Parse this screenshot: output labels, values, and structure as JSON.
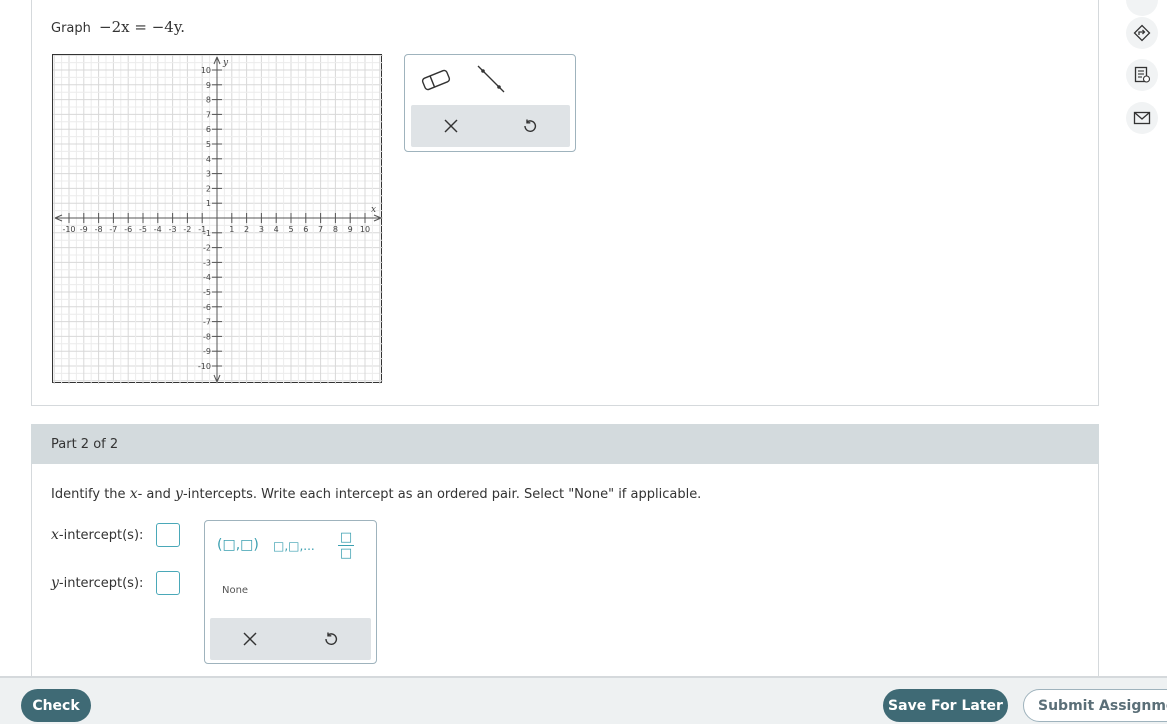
{
  "part1": {
    "prompt_label": "Graph",
    "equation": "−2x = −4y.",
    "graph": {
      "x_axis_label": "x",
      "y_axis_label": "y",
      "x_tick_labels": [
        "-10",
        "-9",
        "-8",
        "-7",
        "-6",
        "-5",
        "-4",
        "-3",
        "-2",
        "-1",
        "1",
        "2",
        "3",
        "4",
        "5",
        "6",
        "7",
        "8",
        "9",
        "10"
      ],
      "y_tick_labels": [
        "10",
        "9",
        "8",
        "7",
        "6",
        "5",
        "4",
        "3",
        "2",
        "1",
        "-1",
        "-2",
        "-3",
        "-4",
        "-5",
        "-6",
        "-7",
        "-8",
        "-9",
        "-10"
      ],
      "x_range": [
        -10,
        10
      ],
      "y_range": [
        -10,
        10
      ],
      "grid": true
    },
    "tools": {
      "eraser": "eraser-icon",
      "line": "line-tool-icon",
      "clear": "close-icon",
      "undo": "undo-icon"
    }
  },
  "part2": {
    "header": "Part 2 of 2",
    "instruction_pre": "Identify the ",
    "x_var": "x",
    "instruction_mid": "- and ",
    "y_var": "y",
    "instruction_post": "-intercepts. Write each intercept as an ordered pair. Select \"None\" if applicable.",
    "x_intercept_var": "x",
    "x_intercept_label": "-intercept(s):",
    "y_intercept_var": "y",
    "y_intercept_label": "-intercept(s):",
    "templates": {
      "ordered_pair": "(□,□)",
      "list": "□,□,...",
      "fraction_num": "□",
      "fraction_den": "□"
    },
    "none_label": "None"
  },
  "footer": {
    "check": "Check",
    "save": "Save For Later",
    "submit": "Submit Assignment"
  },
  "colors": {
    "primary": "#3f6a75",
    "accent": "#3a9fb0",
    "header_bg": "#d3dadd"
  }
}
